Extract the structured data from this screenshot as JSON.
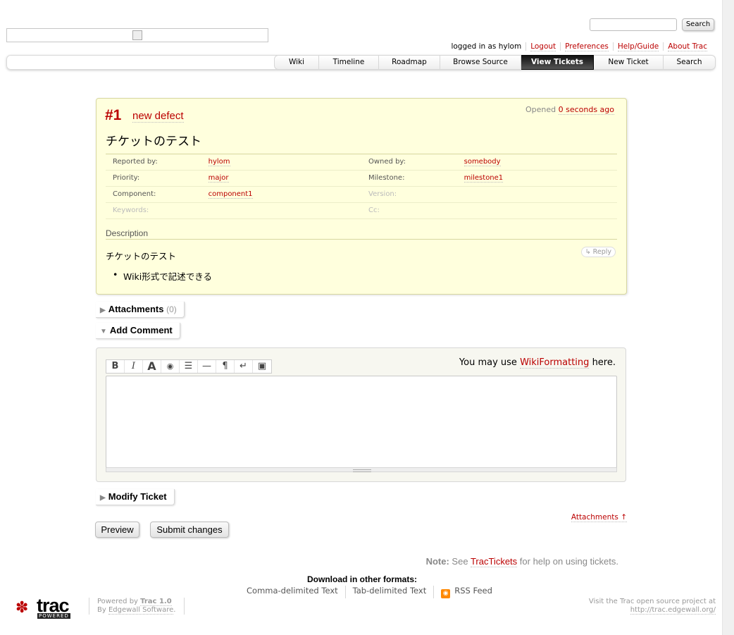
{
  "header": {
    "search_button": "Search",
    "metanav": [
      "logged in as hylom",
      "Logout",
      "Preferences",
      "Help/Guide",
      "About Trac"
    ],
    "mainnav": [
      {
        "label": "Wiki",
        "width": 64
      },
      {
        "label": "Timeline",
        "width": 85
      },
      {
        "label": "Roadmap",
        "width": 87
      },
      {
        "label": "Browse Source",
        "width": 115
      },
      {
        "label": "View Tickets",
        "width": 103,
        "active": true
      },
      {
        "label": "New Ticket",
        "width": 99
      },
      {
        "label": "Search",
        "width": 74
      }
    ]
  },
  "ticket": {
    "id": "#1",
    "type": "new defect",
    "opened_label": "Opened",
    "opened_time": "0 seconds ago",
    "summary": "チケットのテスト",
    "props": {
      "reported_by_label": "Reported by:",
      "reported_by": "hylom",
      "owned_by_label": "Owned by:",
      "owned_by": "somebody",
      "priority_label": "Priority:",
      "priority": "major",
      "milestone_label": "Milestone:",
      "milestone": "milestone1",
      "component_label": "Component:",
      "component": "component1",
      "version_label": "Version:",
      "keywords_label": "Keywords:",
      "cc_label": "Cc:"
    },
    "description_heading": "Description",
    "reply": "↳ Reply",
    "description_text": "チケットのテスト",
    "description_bullet": "Wiki形式で記述できる"
  },
  "attachments": {
    "label": "Attachments",
    "count": "(0)"
  },
  "add_comment": {
    "label": "Add Comment",
    "toolbar": [
      "B",
      "I",
      "A",
      "◉",
      "☰",
      "—",
      "¶",
      "↵",
      "▣"
    ],
    "hint_prefix": "You may use",
    "hint_link": "WikiFormatting",
    "hint_suffix": "here."
  },
  "modify_ticket": {
    "label": "Modify Ticket"
  },
  "attachments_link": "Attachments ↑",
  "buttons": {
    "preview": "Preview",
    "submit": "Submit changes"
  },
  "note": {
    "label": "Note:",
    "pre": "See",
    "link": "TracTickets",
    "post": "for help on using tickets."
  },
  "download": {
    "heading": "Download in other formats:",
    "formats": [
      "Comma-delimited Text",
      "Tab-delimited Text",
      "RSS Feed"
    ]
  },
  "footer": {
    "logo_text": "trac",
    "logo_badge": "POWERED",
    "powered_by": "Powered by",
    "trac_version": "Trac 1.0",
    "by": "By",
    "edgewall": "Edgewall Software",
    "visit_text": "Visit the Trac open source project at",
    "visit_url": "http://trac.edgewall.org/"
  }
}
